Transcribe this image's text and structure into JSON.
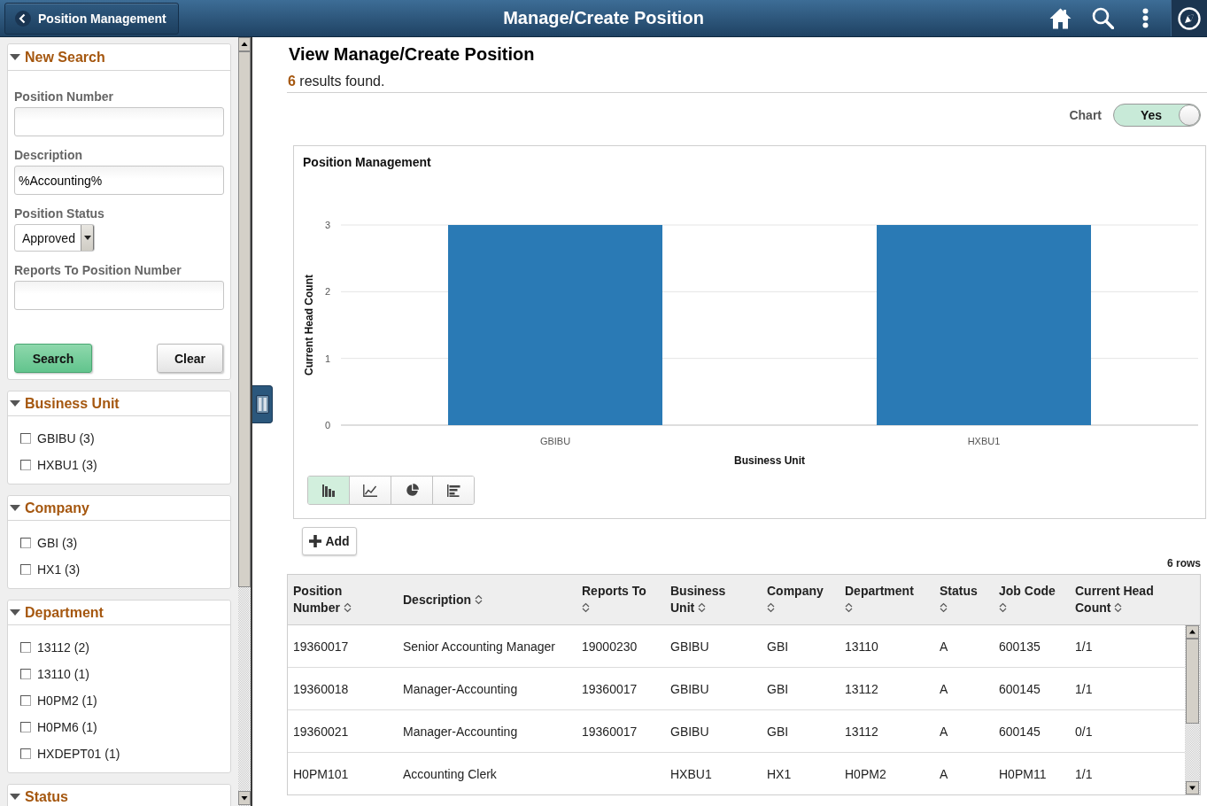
{
  "header": {
    "back_button": "Position Management",
    "title": "Manage/Create Position"
  },
  "search_panel": {
    "title": "New Search",
    "expanded": true,
    "fields": [
      {
        "kind": "input",
        "label": "Position Number"
      },
      {
        "kind": "input",
        "label": "Description",
        "value": "%Accounting%"
      },
      {
        "kind": "select",
        "label": "Position Status",
        "value": "Approved"
      },
      {
        "kind": "input",
        "label": "Reports To Position Number"
      }
    ],
    "buttons": [
      {
        "kind": "primary",
        "label": "Search"
      },
      {
        "kind": "secondary",
        "label": "Clear"
      }
    ]
  },
  "facets": [
    {
      "title": "Business Unit",
      "expanded": true,
      "options": [
        {
          "label": "GBIBU (3)",
          "checked": false
        },
        {
          "label": "HXBU1 (3)",
          "checked": false
        }
      ]
    },
    {
      "title": "Company",
      "expanded": true,
      "options": [
        {
          "label": "GBI (3)",
          "checked": false
        },
        {
          "label": "HX1 (3)",
          "checked": false
        }
      ]
    },
    {
      "title": "Department",
      "expanded": true,
      "options": [
        {
          "label": "13112 (2)",
          "checked": false
        },
        {
          "label": "13110 (1)",
          "checked": false
        },
        {
          "label": "H0PM2 (1)",
          "checked": false
        },
        {
          "label": "H0PM6 (1)",
          "checked": false
        },
        {
          "label": "HXDEPT01 (1)",
          "checked": false
        }
      ]
    },
    {
      "title": "Status",
      "expanded": true
    }
  ],
  "results": {
    "title": "View Manage/Create Position",
    "summary": "**6** results found.",
    "chart_toggle": {
      "label": "Chart",
      "on": true,
      "value": "Yes"
    },
    "chart": {
      "chart_data": [
        {
          "type": "bar",
          "title": "Position Management",
          "xlabel": "Business Unit",
          "ylabel": "Current Head Count",
          "categories": [
            "GBIBU",
            "HXBU1"
          ],
          "values": [
            3,
            3
          ],
          "color": "#2a7ab5",
          "yticks": [
            0,
            1,
            2,
            3
          ],
          "ylim": [
            0,
            3
          ],
          "grid": true
        }
      ],
      "chart_types": [
        {
          "kind": "bar",
          "selected": true
        },
        {
          "kind": "line",
          "selected": false
        },
        {
          "kind": "pie",
          "selected": false
        },
        {
          "kind": "horizontal_bar",
          "selected": false
        }
      ]
    },
    "add_button": "Add",
    "row_count": "6 rows",
    "table": {
      "columns": [
        {
          "label": "Position Number"
        },
        {
          "label": "Description"
        },
        {
          "label": "Reports To"
        },
        {
          "label": "Business Unit"
        },
        {
          "label": "Company"
        },
        {
          "label": "Department"
        },
        {
          "label": "Status"
        },
        {
          "label": "Job Code"
        },
        {
          "label": "Current Head Count"
        }
      ],
      "rows": [
        [
          "19360017",
          "Senior Accounting Manager",
          "19000230",
          "GBIBU",
          "GBI",
          "13110",
          "A",
          "600135",
          "1/1"
        ],
        [
          "19360018",
          "Manager-Accounting",
          "19360017",
          "GBIBU",
          "GBI",
          "13112",
          "A",
          "600145",
          "1/1"
        ],
        [
          "19360021",
          "Manager-Accounting",
          "19360017",
          "GBIBU",
          "GBI",
          "13112",
          "A",
          "600145",
          "0/1"
        ],
        [
          "H0PM101",
          "Accounting Clerk",
          null,
          "HXBU1",
          "HX1",
          "H0PM2",
          "A",
          "H0PM11",
          "1/1"
        ]
      ]
    }
  }
}
